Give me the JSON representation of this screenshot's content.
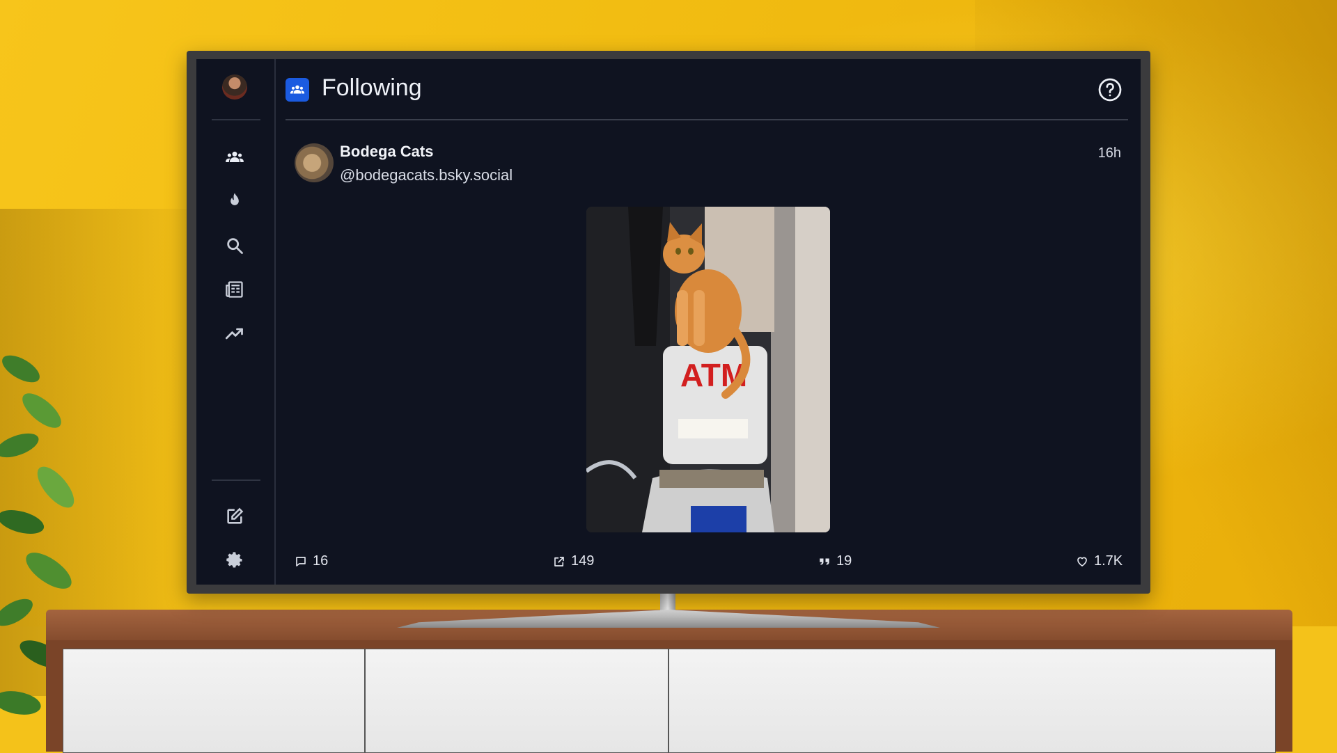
{
  "header": {
    "title": "Following",
    "help_icon": "help-circle-icon",
    "badge_icon": "people-icon"
  },
  "sidebar": {
    "items": [
      {
        "name": "following",
        "icon": "people-icon"
      },
      {
        "name": "hot",
        "icon": "flame-icon"
      },
      {
        "name": "search",
        "icon": "search-icon"
      },
      {
        "name": "feeds",
        "icon": "newspaper-icon"
      },
      {
        "name": "trending",
        "icon": "trending-up-icon"
      },
      {
        "name": "compose",
        "icon": "edit-icon"
      },
      {
        "name": "settings",
        "icon": "gear-icon"
      }
    ]
  },
  "post": {
    "author_name": "Bodega Cats",
    "handle": "@bodegacats.bsky.social",
    "time": "16h",
    "image_sign_text": "ATM",
    "counts": {
      "replies": "16",
      "reposts": "149",
      "quotes": "19",
      "likes": "1.7K"
    }
  },
  "colors": {
    "screen_bg": "#0f1320",
    "accent": "#1b5be0",
    "wall": "#f4c21a"
  }
}
